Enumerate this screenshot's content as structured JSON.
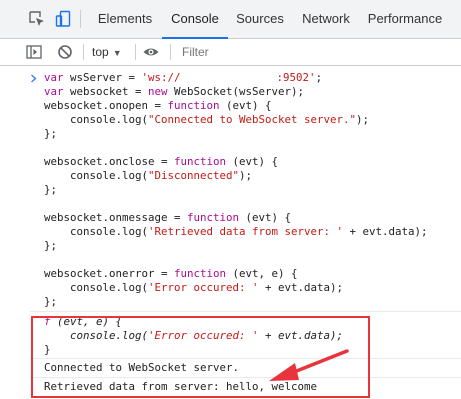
{
  "tabs": [
    {
      "label": "Elements",
      "active": false
    },
    {
      "label": "Console",
      "active": true
    },
    {
      "label": "Sources",
      "active": false
    },
    {
      "label": "Network",
      "active": false
    },
    {
      "label": "Performance",
      "active": false
    }
  ],
  "toolbar": {
    "context": "top",
    "filter_placeholder": "Filter"
  },
  "code": {
    "l1a": "var",
    "l1b": " wsServer = ",
    "l1c": "'ws://",
    "l1d": ":9502'",
    "l1e": ";",
    "l2a": "var",
    "l2b": " websocket = ",
    "l2c": "new",
    "l2d": " WebSocket(wsServer);",
    "l3a": "websocket.onopen = ",
    "l3b": "function",
    "l3c": " (evt) {",
    "l4a": "    console.log(",
    "l4b": "\"Connected to WebSocket server.\"",
    "l4c": ");",
    "l5": "};",
    "l6a": "websocket.onclose = ",
    "l6b": "function",
    "l6c": " (evt) {",
    "l7a": "    console.log(",
    "l7b": "\"Disconnected\"",
    "l7c": ");",
    "l8": "};",
    "l9a": "websocket.onmessage = ",
    "l9b": "function",
    "l9c": " (evt) {",
    "l10a": "    console.log(",
    "l10b": "'Retrieved data from server: '",
    "l10c": " + evt.data);",
    "l11": "};",
    "l12a": "websocket.onerror = ",
    "l12b": "function",
    "l12c": " (evt, e) {",
    "l13a": "    console.log(",
    "l13b": "'Error occured: '",
    "l13c": " + evt.data);",
    "l14": "};"
  },
  "result": {
    "r1a": "f",
    "r1b": " (evt, e) {",
    "r2a": "    console.log(",
    "r2b": "'Error occured: '",
    "r2c": " + evt.data);",
    "r3": "}"
  },
  "output": [
    "Connected to WebSocket server.",
    "Retrieved data from server: hello, welcome"
  ],
  "colors": {
    "keyword": "#aa0d91",
    "string": "#c41a16",
    "highlight_box": "#e8343a",
    "active_tab": "#1a73e8"
  },
  "icons": [
    "inspect-icon",
    "device-toolbar-icon",
    "sidebar-toggle-icon",
    "clear-console-icon",
    "eye-icon",
    "prompt-chevron-icon",
    "arrow-annotation-icon"
  ]
}
